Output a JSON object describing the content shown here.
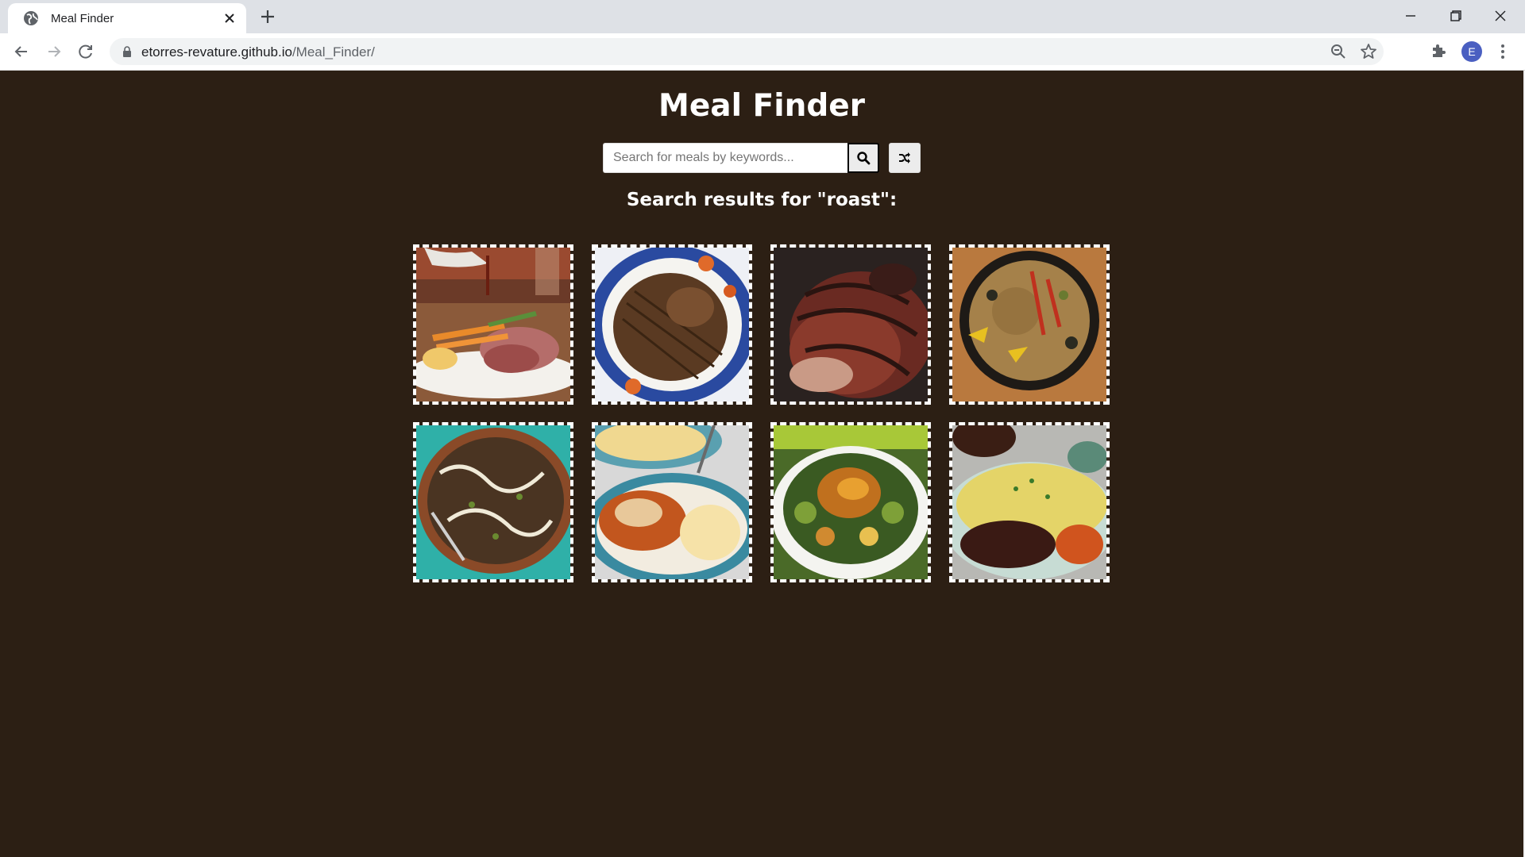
{
  "browser": {
    "tab_title": "Meal Finder",
    "url_domain": "etorres-revature.github.io",
    "url_path": "/Meal_Finder/",
    "profile_initial": "E"
  },
  "page": {
    "title": "Meal Finder",
    "search": {
      "placeholder": "Search for meals by keywords...",
      "value": ""
    },
    "search_button_icon": "search-icon",
    "random_button_icon": "shuffle-icon",
    "result_heading": "Search results for \"roast\":",
    "meals": [
      {
        "image": "roast-beef-with-carrots-and-gravy"
      },
      {
        "image": "sliced-pot-roast-on-blue-platter"
      },
      {
        "image": "roasted-lamb-rack"
      },
      {
        "image": "paella-in-black-pan"
      },
      {
        "image": "lentil-stew-with-yogurt"
      },
      {
        "image": "bbq-chicken-with-mac-and-cheese"
      },
      {
        "image": "roast-chicken-with-vegetables"
      },
      {
        "image": "beef-with-mashed-potatoes"
      }
    ]
  },
  "colors": {
    "page_background": "#2c1f14",
    "meal_border": "#ffffff"
  }
}
